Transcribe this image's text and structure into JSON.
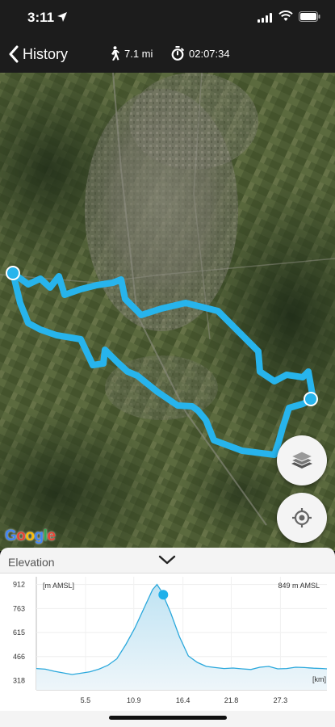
{
  "status_bar": {
    "time": "3:11"
  },
  "nav": {
    "back_label": "History",
    "distance": "7.1 mi",
    "duration": "02:07:34"
  },
  "map": {
    "attribution": "Google",
    "route_color": "#27b4ec"
  },
  "elevation": {
    "title": "Elevation",
    "unit_label": "[m AMSL]",
    "current_value": "849 m AMSL",
    "x_unit": "[km]"
  },
  "chart_data": {
    "type": "area",
    "title": "",
    "ylabel": "[m AMSL]",
    "xlabel": "[km]",
    "ylim": [
      260,
      960
    ],
    "xlim": [
      0,
      32.5
    ],
    "y_ticks": [
      "912",
      "763",
      "615",
      "466",
      "318"
    ],
    "y_tick_values": [
      912,
      763,
      615,
      466,
      318
    ],
    "x_ticks": [
      "5.5",
      "10.9",
      "16.4",
      "21.8",
      "27.3"
    ],
    "x_tick_values": [
      5.5,
      10.9,
      16.4,
      21.8,
      27.3
    ],
    "grid": true,
    "series": [
      {
        "x": [
          0,
          1,
          2,
          3,
          4,
          5,
          6,
          7,
          8,
          9,
          10,
          11,
          12,
          13,
          13.5,
          14,
          15,
          16,
          17,
          18,
          19,
          20,
          21,
          22,
          23,
          24,
          25,
          26,
          27,
          28,
          29,
          30,
          31,
          32,
          32.5
        ],
        "values": [
          392,
          388,
          375,
          365,
          355,
          363,
          372,
          388,
          412,
          452,
          540,
          640,
          760,
          880,
          912,
          870,
          740,
          590,
          470,
          430,
          405,
          398,
          392,
          395,
          390,
          386,
          400,
          405,
          390,
          392,
          400,
          398,
          394,
          392,
          390
        ]
      }
    ],
    "marker": {
      "x": 14.2,
      "y": 849
    }
  }
}
